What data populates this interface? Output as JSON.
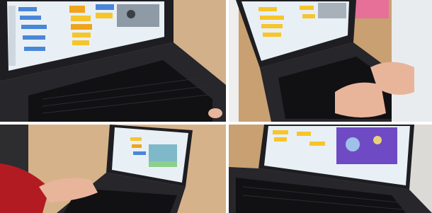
{
  "photo_collage": {
    "panels": [
      {
        "subject": "laptop-with-scratch-editor-closeup"
      },
      {
        "subject": "child-typing-on-laptop"
      },
      {
        "subject": "child-using-laptop-trackpad"
      },
      {
        "subject": "laptop-showing-purple-stage"
      }
    ]
  },
  "colors": {
    "table_wood": "#c9a070",
    "laptop_body": "#1e1e22",
    "keyboard": "#111114",
    "screen_bg": "#e8f0f6",
    "block_orange": "#f0a41a",
    "block_blue": "#4a86d8",
    "block_yellow": "#f6c52b",
    "stage_purple": "#6e4bc4",
    "sleeve_red": "#b31b23"
  }
}
